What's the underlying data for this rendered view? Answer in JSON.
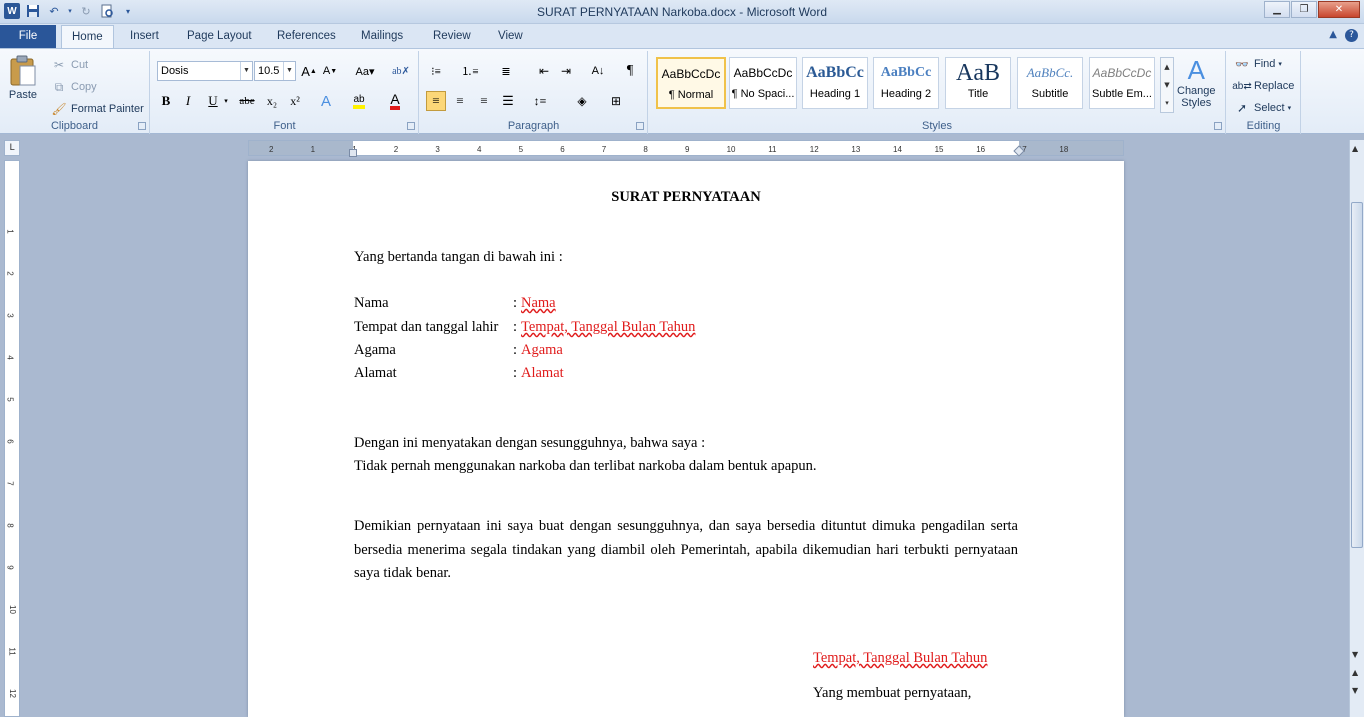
{
  "window": {
    "title": "SURAT PERNYATAAN Narkoba.docx  -  Microsoft Word",
    "word_icon": "W"
  },
  "tabs": [
    {
      "label": "File"
    },
    {
      "label": "Home"
    },
    {
      "label": "Insert"
    },
    {
      "label": "Page Layout"
    },
    {
      "label": "References"
    },
    {
      "label": "Mailings"
    },
    {
      "label": "Review"
    },
    {
      "label": "View"
    }
  ],
  "clipboard": {
    "paste": "Paste",
    "cut": "Cut",
    "copy": "Copy",
    "format_painter": "Format Painter",
    "label": "Clipboard"
  },
  "font": {
    "name": "Dosis",
    "size": "10.5",
    "label": "Font",
    "bold": "B",
    "italic": "I",
    "underline": "U",
    "strike": "abe",
    "sub": "x₂",
    "sup": "x²"
  },
  "paragraph": {
    "label": "Paragraph"
  },
  "styles": {
    "label": "Styles",
    "items": [
      {
        "preview": "AaBbCcDc",
        "name": "¶ Normal"
      },
      {
        "preview": "AaBbCcDc",
        "name": "¶ No Spaci..."
      },
      {
        "preview": "AaBbCc",
        "name": "Heading 1"
      },
      {
        "preview": "AaBbCc",
        "name": "Heading 2"
      },
      {
        "preview": "AaB",
        "name": "Title"
      },
      {
        "preview": "AaBbCc.",
        "name": "Subtitle"
      },
      {
        "preview": "AaBbCcDc",
        "name": "Subtle Em..."
      }
    ],
    "change_styles_1": "Change",
    "change_styles_2": "Styles"
  },
  "editing": {
    "find": "Find",
    "replace": "Replace",
    "select": "Select",
    "label": "Editing"
  },
  "ruler": {
    "h_ticks": [
      "2",
      "1",
      "1",
      "2",
      "3",
      "4",
      "5",
      "6",
      "7",
      "8",
      "9",
      "10",
      "11",
      "12",
      "13",
      "14",
      "15",
      "16",
      "17",
      "18"
    ],
    "v_ticks": [
      "1",
      "2",
      "3",
      "4",
      "5",
      "6",
      "7",
      "8",
      "9",
      "10",
      "11",
      "12"
    ]
  },
  "document": {
    "heading": "SURAT PERNYATAAN",
    "intro": "Yang bertanda tangan di bawah ini :",
    "fields": [
      {
        "label": "Nama",
        "sep": ":",
        "value": "Nama"
      },
      {
        "label": "Tempat dan tanggal lahir",
        "sep": ":",
        "value": "Tempat, Tanggal  Bulan Tahun"
      },
      {
        "label": "Agama",
        "sep": ":",
        "value": "Agama"
      },
      {
        "label": "Alamat",
        "sep": ":",
        "value": "Alamat"
      }
    ],
    "statement_1": "Dengan ini menyatakan dengan sesungguhnya, bahwa saya :",
    "statement_2": "Tidak pernah menggunakan narkoba dan terlibat narkoba dalam bentuk apapun.",
    "closing": "Demikian pernyataan ini saya buat dengan sesungguhnya, dan saya bersedia dituntut dimuka pengadilan serta bersedia menerima segala tindakan yang diambil oleh Pemerintah, apabila dikemudian hari terbukti pernyataan saya tidak benar.",
    "place_date": "Tempat, Tanggal  Bulan Tahun",
    "signer": "Yang membuat pernyataan,"
  }
}
